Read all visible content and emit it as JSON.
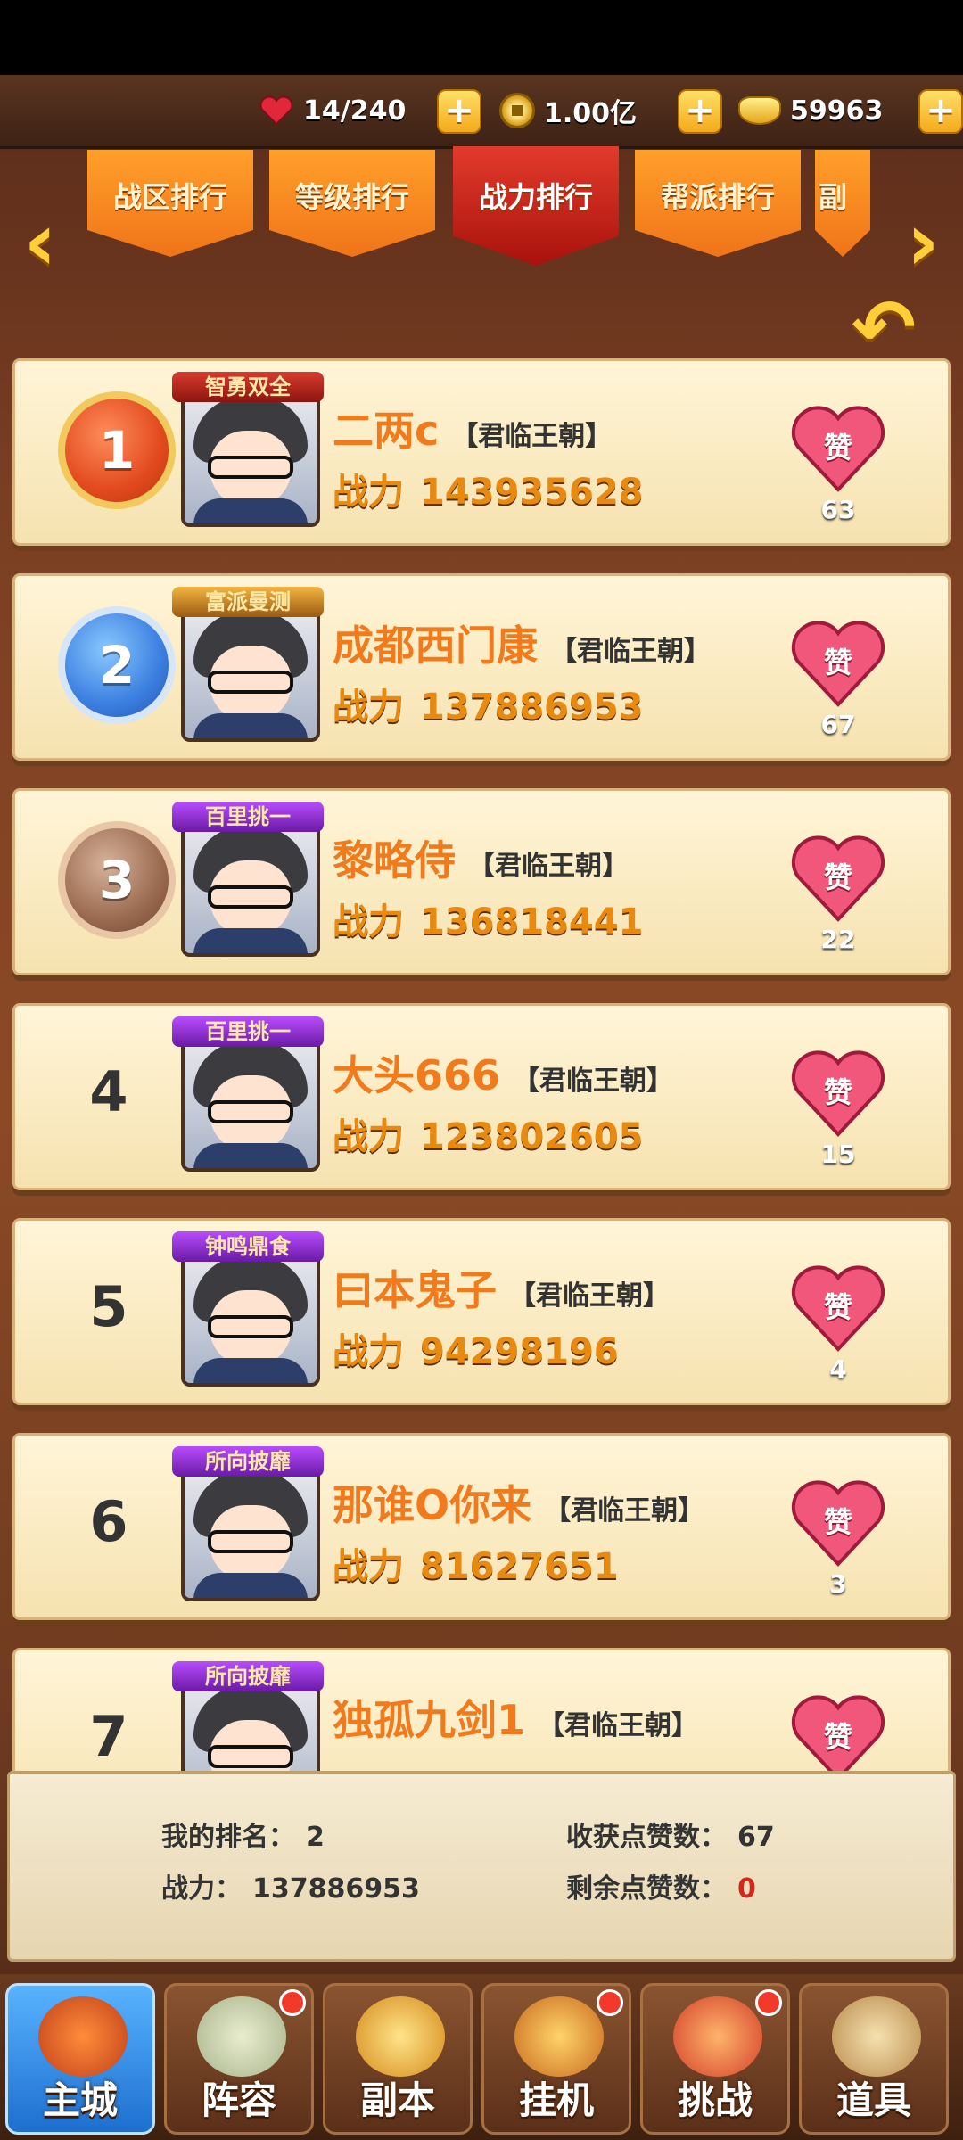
{
  "resources": {
    "stamina": "14/240",
    "coins": "1.00亿",
    "ingots": "59963",
    "plus": "+"
  },
  "tabs": [
    {
      "label": "战区排行",
      "active": false
    },
    {
      "label": "等级排行",
      "active": false
    },
    {
      "label": "战力排行",
      "active": true
    },
    {
      "label": "帮派排行",
      "active": false
    },
    {
      "label": "副",
      "active": false
    }
  ],
  "arrows": {
    "left": "‹",
    "right": "›",
    "back": "↶"
  },
  "power_label": "战力",
  "like_label": "赞",
  "ranks": [
    {
      "rank": "1",
      "medal": "gold",
      "title": "智勇双全",
      "title_style": "red",
      "name": "二两c",
      "guild": "【君临王朝】",
      "power": "143935628",
      "likes": "63"
    },
    {
      "rank": "2",
      "medal": "silver",
      "title": "富派曼测",
      "title_style": "gold",
      "name": "成都西门康",
      "guild": "【君临王朝】",
      "power": "137886953",
      "likes": "67"
    },
    {
      "rank": "3",
      "medal": "bronze",
      "title": "百里挑一",
      "title_style": "purple",
      "name": "黎略侍",
      "guild": "【君临王朝】",
      "power": "136818441",
      "likes": "22"
    },
    {
      "rank": "4",
      "medal": "",
      "title": "百里挑一",
      "title_style": "purple",
      "name": "大头666",
      "guild": "【君临王朝】",
      "power": "123802605",
      "likes": "15"
    },
    {
      "rank": "5",
      "medal": "",
      "title": "钟鸣鼎食",
      "title_style": "purple",
      "name": "曰本鬼子",
      "guild": "【君临王朝】",
      "power": "94298196",
      "likes": "4"
    },
    {
      "rank": "6",
      "medal": "",
      "title": "所向披靡",
      "title_style": "purple",
      "name": "那谁O你来",
      "guild": "【君临王朝】",
      "power": "81627651",
      "likes": "3"
    },
    {
      "rank": "7",
      "medal": "",
      "title": "所向披靡",
      "title_style": "purple",
      "name": "独孤九剑1",
      "guild": "【君临王朝】",
      "power": "",
      "likes": ""
    }
  ],
  "my_info": {
    "rank_label": "我的排名：",
    "rank_value": "2",
    "power_label": "战力：",
    "power_value": "137886953",
    "received_label": "收获点赞数：",
    "received_value": "67",
    "remaining_label": "剩余点赞数：",
    "remaining_value": "0"
  },
  "nav": [
    {
      "label": "主城",
      "active": true,
      "dot": false
    },
    {
      "label": "阵容",
      "active": false,
      "dot": true
    },
    {
      "label": "副本",
      "active": false,
      "dot": false
    },
    {
      "label": "挂机",
      "active": false,
      "dot": true
    },
    {
      "label": "挑战",
      "active": false,
      "dot": true
    },
    {
      "label": "道具",
      "active": false,
      "dot": false
    }
  ],
  "colors": {
    "accent_orange": "#f07a1c",
    "active_tab_red": "#c0201a",
    "remaining_red": "#d5261a"
  }
}
